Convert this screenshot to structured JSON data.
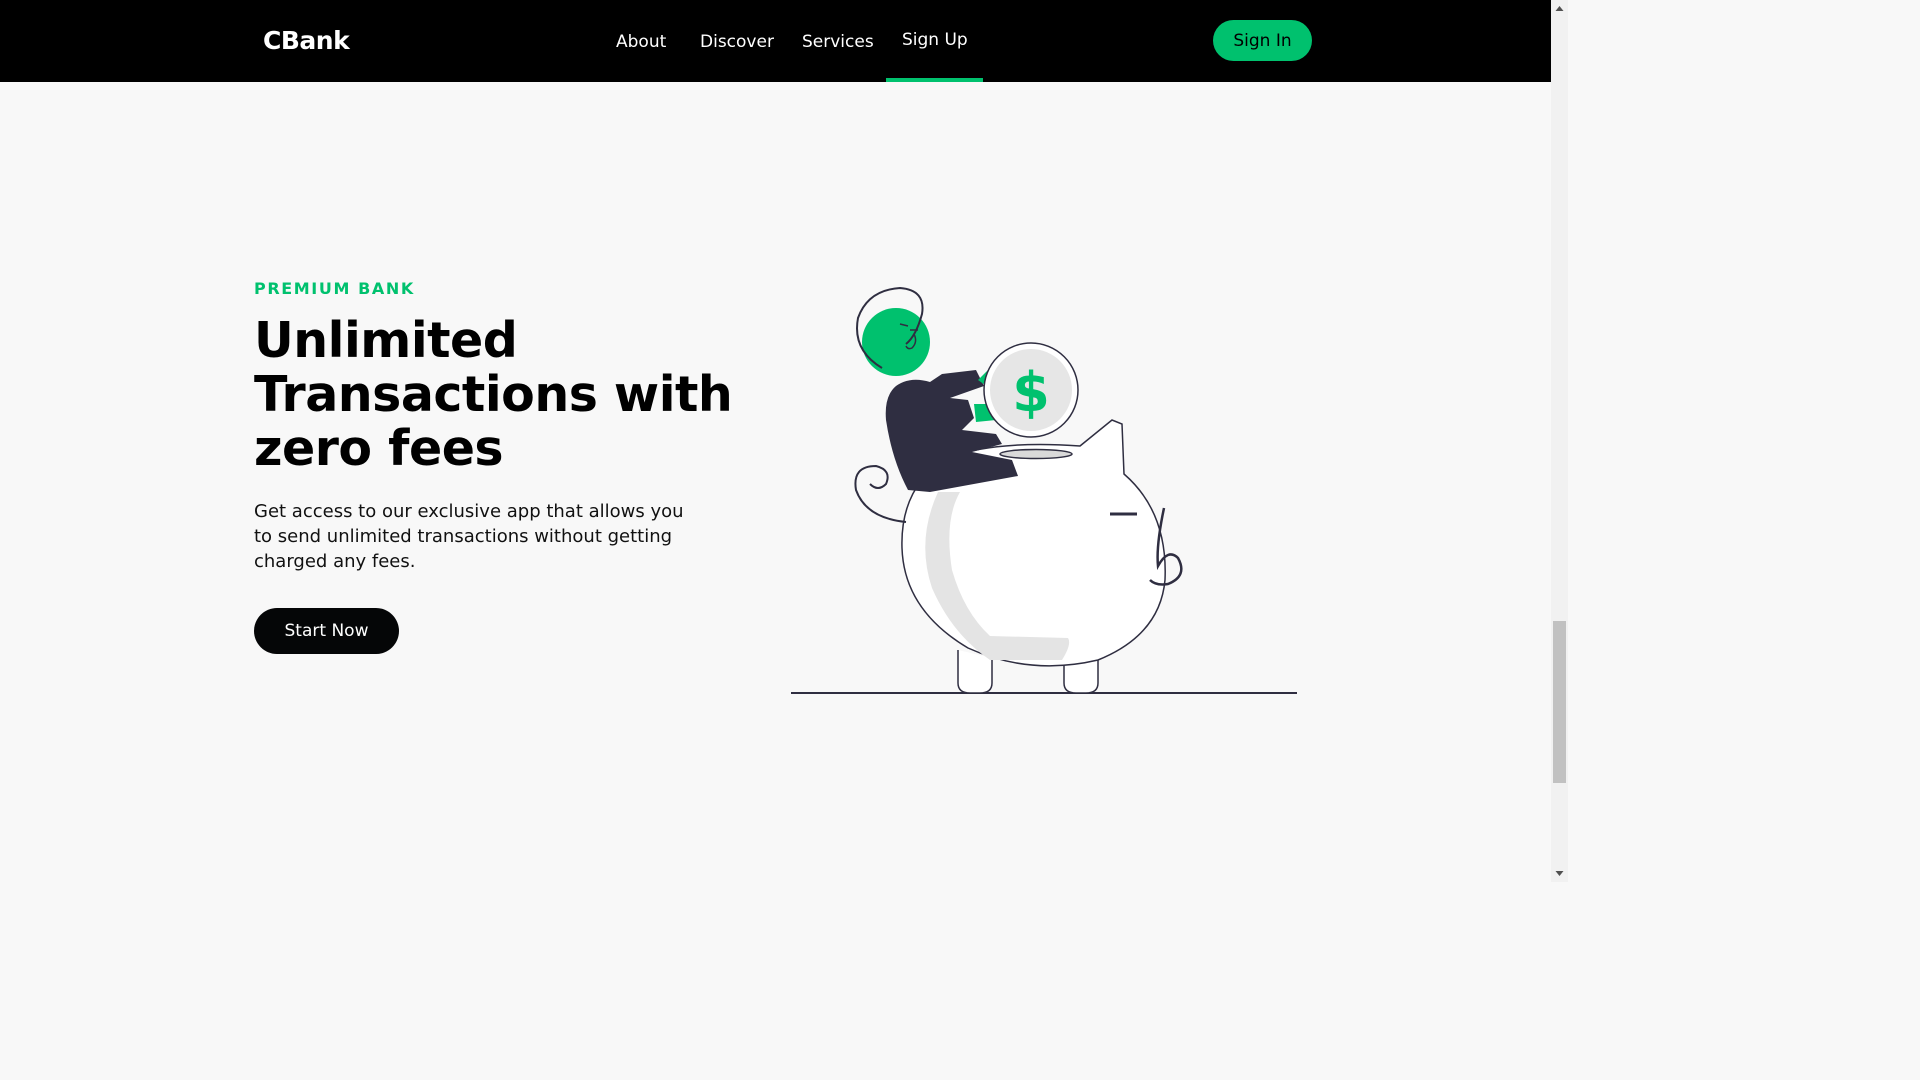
{
  "brand": {
    "logo": "CBank"
  },
  "nav": {
    "items": [
      {
        "label": "About"
      },
      {
        "label": "Discover"
      },
      {
        "label": "Services"
      },
      {
        "label": "Sign Up",
        "active": true
      }
    ],
    "signin_label": "Sign In"
  },
  "hero": {
    "eyebrow": "PREMIUM BANK",
    "headline": "Unlimited Transactions with zero fees",
    "description": "Get access to our exclusive app that allows you to send unlimited transactions without getting charged any fees.",
    "cta_label": "Start Now",
    "illustration_icon": "piggy-bank-coin-illustration",
    "coin_symbol": "$"
  },
  "colors": {
    "accent": "#00c16e",
    "navbar_bg": "#000000",
    "page_bg": "#f8f8f8",
    "dark_ink": "#2f2e41"
  }
}
